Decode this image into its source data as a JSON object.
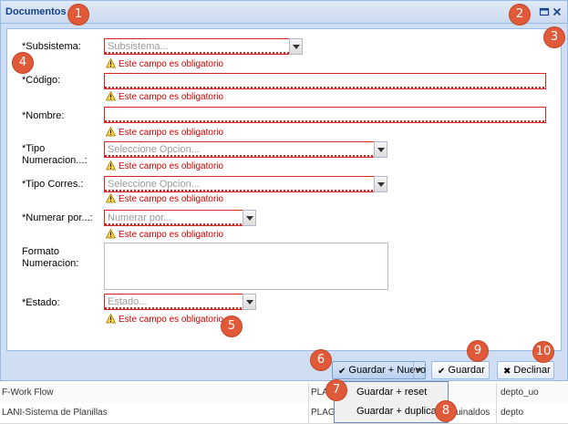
{
  "window": {
    "title": "Documentos"
  },
  "form": {
    "subsistema": {
      "label": "*Subsistema:",
      "placeholder": "Subsistema...",
      "error": "Este campo es obligatorio"
    },
    "codigo": {
      "label": "*Código:",
      "placeholder": "",
      "error": "Este campo es obligatorio"
    },
    "nombre": {
      "label": "*Nombre:",
      "placeholder": "",
      "error": "Este campo es obligatorio"
    },
    "tipo_numeracion": {
      "label_line1": "*Tipo",
      "label_line2": "Numeracion...:",
      "placeholder": "Seleccione Opcion...",
      "error": "Este campo es obligatorio"
    },
    "tipo_corres": {
      "label": "*Tipo Corres.:",
      "placeholder": "Seleccione Opcion...",
      "error": "Este campo es obligatorio"
    },
    "numerar_por": {
      "label": "*Numerar por...:",
      "placeholder": "Numerar por...",
      "error": "Este campo es obligatorio"
    },
    "formato_numeracion": {
      "label_line1": "Formato",
      "label_line2": "Numeracion:"
    },
    "estado": {
      "label": "*Estado:",
      "placeholder": "Estado...",
      "error": "Este campo es obligatorio"
    }
  },
  "footer": {
    "guardar_nuevo": "Guardar + Nuevo",
    "guardar": "Guardar",
    "declinar": "Declinar"
  },
  "menu": {
    "items": [
      "Guardar + reset",
      "Guardar + duplicar"
    ]
  },
  "background_grid": {
    "rows": [
      {
        "col1": "F-Work Flow",
        "col2": "PLAG",
        "col3": "depto_uo"
      },
      {
        "col1": "LANI-Sistema de Planillas",
        "col2": "PLAG",
        "col2b": "uinaldos",
        "col3": "depto"
      }
    ]
  },
  "callouts": [
    "1",
    "2",
    "3",
    "4",
    "5",
    "6",
    "7",
    "8",
    "9",
    "10"
  ],
  "colors": {
    "header_text": "#15428b",
    "error_red": "#dd2222",
    "callout": "#e05a3a"
  }
}
